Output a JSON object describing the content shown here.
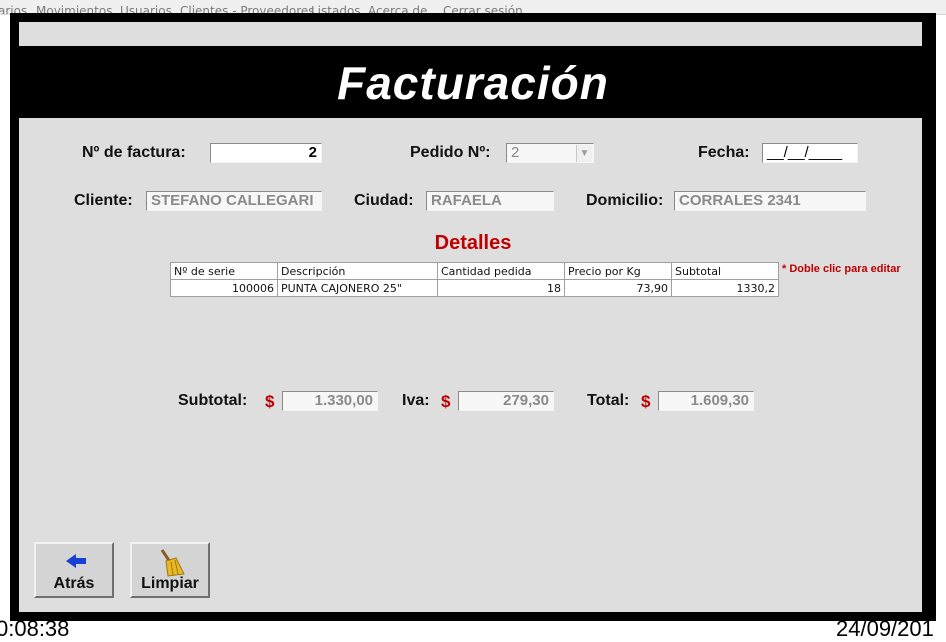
{
  "menu": [
    "arios",
    "Movimientos",
    "Usuarios",
    "Clientes - Proveedores",
    "Listados",
    "Acerca de",
    "Cerrar sesión"
  ],
  "title": "Facturación",
  "form": {
    "factura_label": "Nº de factura:",
    "factura_value": "2",
    "pedido_label": "Pedido Nº:",
    "pedido_value": "2",
    "fecha_label": "Fecha:",
    "fecha_value": "__/__/____",
    "cliente_label": "Cliente:",
    "cliente_value": "STEFANO CALLEGARI",
    "ciudad_label": "Ciudad:",
    "ciudad_value": "RAFAELA",
    "domicilio_label": "Domicilio:",
    "domicilio_value": "CORRALES 2341"
  },
  "detalles": {
    "title": "Detalles",
    "hint": "* Doble clic para editar",
    "columns": [
      "Nº de serie",
      "Descripción",
      "Cantidad pedida",
      "Precio por Kg",
      "Subtotal"
    ],
    "rows": [
      [
        "100006",
        "PUNTA CAJONERO 25\"",
        "18",
        "73,90",
        "1330,2"
      ]
    ]
  },
  "totals": {
    "currency": "$",
    "subtotal_label": "Subtotal:",
    "subtotal_value": "1.330,00",
    "iva_label": "Iva:",
    "iva_value": "279,30",
    "total_label": "Total:",
    "total_value": "1.609,30"
  },
  "buttons": {
    "back_label": "Atrás",
    "back_icon": "arrow-left-icon",
    "clear_label": "Limpiar",
    "clear_icon": "broom-icon"
  },
  "status": {
    "time": "0:08:38",
    "date": "24/09/201"
  },
  "colors": {
    "accent_red": "#c00000",
    "frame": "#000000",
    "panel": "#dedede"
  }
}
